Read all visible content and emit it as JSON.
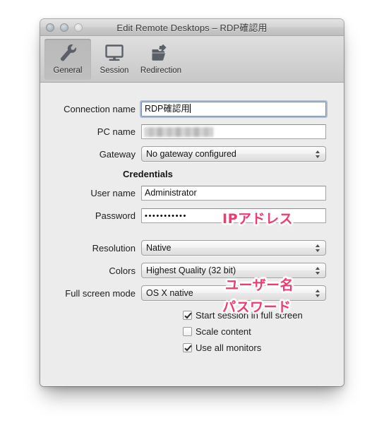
{
  "window": {
    "title": "Edit Remote Desktops – RDP確認用",
    "traffic_lights": [
      "close-button",
      "minimize-button",
      "zoom-button"
    ]
  },
  "toolbar": {
    "items": [
      {
        "label": "General",
        "icon": "wrench-icon",
        "selected": true
      },
      {
        "label": "Session",
        "icon": "monitor-icon",
        "selected": false
      },
      {
        "label": "Redirection",
        "icon": "folder-arrow-icon",
        "selected": false
      }
    ]
  },
  "form": {
    "connection_name": {
      "label": "Connection name",
      "value": "RDP確認用",
      "focused": true
    },
    "pc_name": {
      "label": "PC name",
      "value": "",
      "redacted": true
    },
    "gateway": {
      "label": "Gateway",
      "value": "No gateway configured"
    },
    "credentials_header": "Credentials",
    "user_name": {
      "label": "User name",
      "value": "Administrator"
    },
    "password": {
      "label": "Password",
      "value": "•••••••••••"
    },
    "resolution": {
      "label": "Resolution",
      "value": "Native"
    },
    "colors": {
      "label": "Colors",
      "value": "Highest Quality (32 bit)"
    },
    "full_screen_mode": {
      "label": "Full screen mode",
      "value": "OS X native"
    },
    "checkboxes": [
      {
        "label": "Start session in full screen",
        "checked": true
      },
      {
        "label": "Scale content",
        "checked": false
      },
      {
        "label": "Use all monitors",
        "checked": true
      }
    ]
  },
  "annotations": {
    "color": "#f23a6e",
    "ip": "IPアドレス",
    "user": "ユーザー名",
    "password": "パスワード"
  }
}
